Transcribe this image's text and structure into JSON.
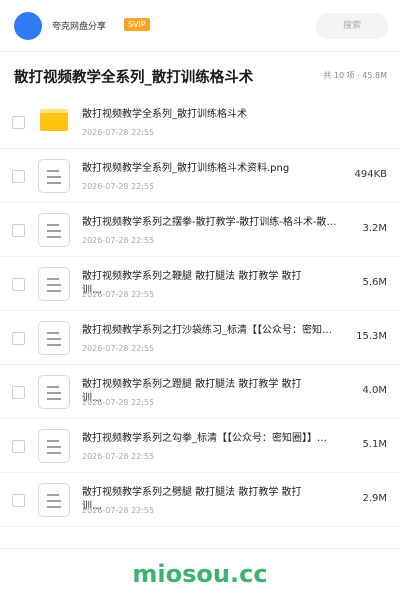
{
  "header": {
    "app_name": "夸克网盘分享",
    "badge": "SVIP",
    "search_placeholder": "搜索"
  },
  "folder": {
    "title": "散打视频教学全系列_散打训练格斗术",
    "summary": "共 10 项 · 45.8M"
  },
  "files": [
    {
      "name": "散打视频教学全系列_散打训练格斗术",
      "date": "2026-07-28 22:55",
      "size": "",
      "icon": "folder-icon",
      "wrap": false
    },
    {
      "name": "散打视频教学全系列_散打训练格斗术资料.png",
      "date": "2026-07-28 22:55",
      "size": "494KB",
      "icon": "document-icon",
      "wrap": false
    },
    {
      "name": "散打视频教学系列之摆拳-散打教学-散打训练-格斗术-散打视频教学",
      "date": "2026-07-28 22:55",
      "size": "3.2M",
      "icon": "document-icon",
      "wrap": false
    },
    {
      "name": "散打视频教学系列之鞭腿 散打腿法 散打教学 散打训…",
      "date": "2026-07-28 22:55",
      "size": "5.6M",
      "icon": "document-icon",
      "wrap": true
    },
    {
      "name": "散打视频教学系列之打沙袋练习_标清【【公众号：密知圈】】",
      "date": "2026-07-28 22:55",
      "size": "15.3M",
      "icon": "document-icon",
      "wrap": false
    },
    {
      "name": "散打视频教学系列之蹬腿 散打腿法 散打教学 散打训…",
      "date": "2026-07-28 22:55",
      "size": "4.0M",
      "icon": "document-icon",
      "wrap": true
    },
    {
      "name": "散打视频教学系列之勾拳_标清【【公众号：密知圈】】…",
      "date": "2026-07-28 22:55",
      "size": "5.1M",
      "icon": "document-icon",
      "wrap": false
    },
    {
      "name": "散打视频教学系列之劈腿 散打腿法 散打教学 散打训…",
      "date": "2026-07-28 22:55",
      "size": "2.9M",
      "icon": "document-icon",
      "wrap": true
    }
  ],
  "watermark": "miosou.cc",
  "colors": {
    "accent": "#2f7bf5",
    "badge": "#f6a524",
    "folder": "#ffc412",
    "watermark": "#3cb371"
  }
}
